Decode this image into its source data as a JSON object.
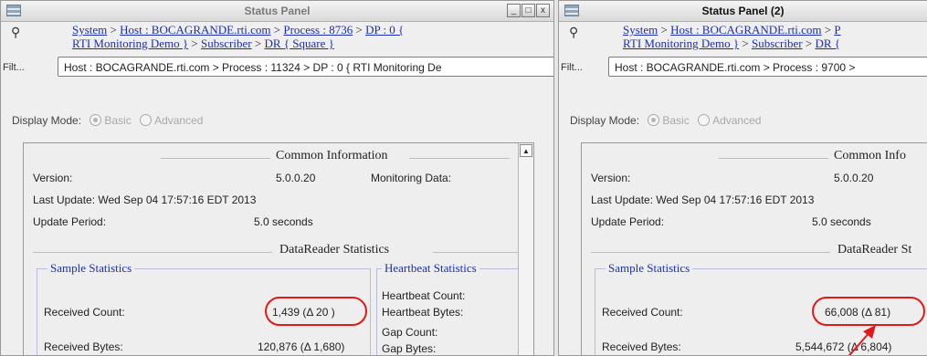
{
  "panels": [
    {
      "title": "Status Panel",
      "crumbs": {
        "system": "System",
        "sep": ">",
        "host": "Host : BOCAGRANDE.rti.com",
        "process": "Process : 8736",
        "dp": "DP : 0 {",
        "dp2": "RTI Monitoring Demo }",
        "subscriber": "Subscriber",
        "dr": "DR { Square }"
      },
      "filter_label": "Filt...",
      "filter_value": "Host : BOCAGRANDE.rti.com > Process : 11324 > DP : 0 { RTI Monitoring De",
      "display_label": "Display Mode:",
      "mode_basic": "Basic",
      "mode_advanced": "Advanced",
      "common_title": "Common Information",
      "version_label": "Version:",
      "version_value": "5.0.0.20",
      "monitoring_label": "Monitoring Data:",
      "last_update": "Last Update: Wed Sep 04 17:57:16 EDT 2013",
      "period_label": "Update Period:",
      "period_value": "5.0 seconds",
      "dr_title": "DataReader Statistics",
      "sample_title": "Sample Statistics",
      "received_count_label": "Received Count:",
      "received_count_value": "1,439 (Δ 20 )",
      "received_bytes_label": "Received Bytes:",
      "received_bytes_value": "120,876 (Δ 1,680)",
      "heartbeat_title": "Heartbeat Statistics",
      "hb_count": "Heartbeat Count:",
      "hb_bytes": "Heartbeat Bytes:",
      "gap_count": "Gap Count:",
      "gap_bytes": "Gap Bytes:"
    },
    {
      "title": "Status Panel (2)",
      "crumbs": {
        "system": "System",
        "sep": ">",
        "host": "Host : BOCAGRANDE.rti.com",
        "process": "P",
        "dp": "",
        "dp2": "RTI Monitoring Demo }",
        "subscriber": "Subscriber",
        "dr": "DR {"
      },
      "filter_label": "Filt...",
      "filter_value": "Host : BOCAGRANDE.rti.com > Process : 9700 >",
      "display_label": "Display Mode:",
      "mode_basic": "Basic",
      "mode_advanced": "Advanced",
      "common_title": "Common Info",
      "version_label": "Version:",
      "version_value": "5.0.0.20",
      "last_update": "Last Update: Wed Sep 04 17:57:16 EDT 2013",
      "period_label": "Update Period:",
      "period_value": "5.0 seconds",
      "dr_title": "DataReader St",
      "sample_title": "Sample Statistics",
      "received_count_label": "Received Count:",
      "received_count_value": "66,008 (Δ 81)",
      "received_bytes_label": "Received Bytes:",
      "received_bytes_value": "5,544,672 (Δ 6,804)"
    }
  ],
  "window_buttons": {
    "minimize": "_",
    "maximize": "□",
    "close": "x"
  },
  "scroll_up": "▲",
  "accent": {
    "link": "#1c2fb0",
    "highlight": "#e21919"
  }
}
